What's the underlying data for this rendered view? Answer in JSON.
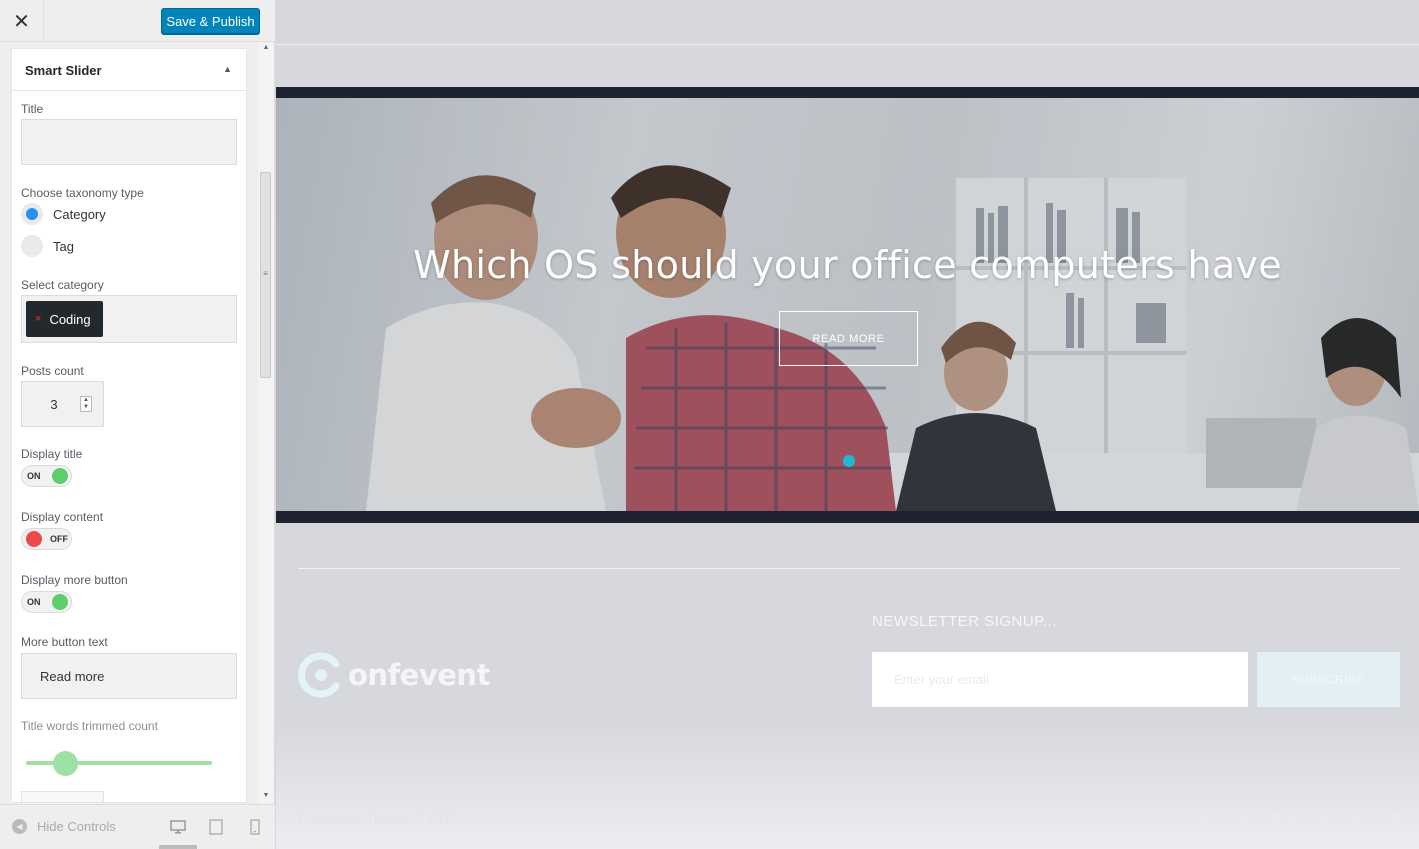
{
  "toolbar": {
    "close_glyph": "✕",
    "save_label": "Save & Publish",
    "colors": {
      "primary": "#0085ba"
    }
  },
  "panel": {
    "title": "Smart Slider",
    "collapse_glyph": "▲",
    "title_field": {
      "label": "Title",
      "value": ""
    },
    "taxonomy": {
      "label": "Choose taxonomy type",
      "options": [
        {
          "label": "Category",
          "selected": true
        },
        {
          "label": "Tag",
          "selected": false
        }
      ]
    },
    "select_category": {
      "label": "Select category",
      "tags": [
        "Coding"
      ],
      "remove_glyph": "×"
    },
    "posts_count": {
      "label": "Posts count",
      "value": "3"
    },
    "display_title": {
      "label": "Display title",
      "state": "ON"
    },
    "display_content": {
      "label": "Display content",
      "state": "OFF"
    },
    "display_more_button": {
      "label": "Display more button",
      "state": "ON"
    },
    "more_button_text": {
      "label": "More button text",
      "value": "Read more"
    },
    "title_words_trimmed": {
      "label": "Title words trimmed count"
    },
    "colors": {
      "on": "#5ccf6a",
      "off": "#ef4a4a",
      "radio": "#2a8ff2",
      "slider": "#9ee0a6"
    }
  },
  "footer_controls": {
    "hide_label": "Hide Controls",
    "devices": [
      "desktop-icon",
      "tablet-icon",
      "mobile-icon"
    ]
  },
  "preview": {
    "hero": {
      "headline": "Which OS should your office computers have",
      "button": "READ MORE",
      "dot_color": "#22b8d4"
    },
    "newsletter": {
      "title": "NEWSLETTER SIGNUP...",
      "placeholder": "Enter your email",
      "button": "SUBSCRIBE"
    },
    "logo_text": "onfevent",
    "copyright": "Confevent Theme © 2017",
    "social": [
      {
        "icon": "facebook-icon",
        "glyph": "f"
      },
      {
        "icon": "twitter-icon",
        "glyph": "t"
      },
      {
        "icon": "google-plus-icon",
        "glyph": "G+"
      },
      {
        "icon": "vimeo-icon",
        "glyph": "v"
      },
      {
        "icon": "youtube-icon",
        "glyph": "▶"
      },
      {
        "icon": "pinterest-icon",
        "glyph": "P"
      }
    ]
  }
}
